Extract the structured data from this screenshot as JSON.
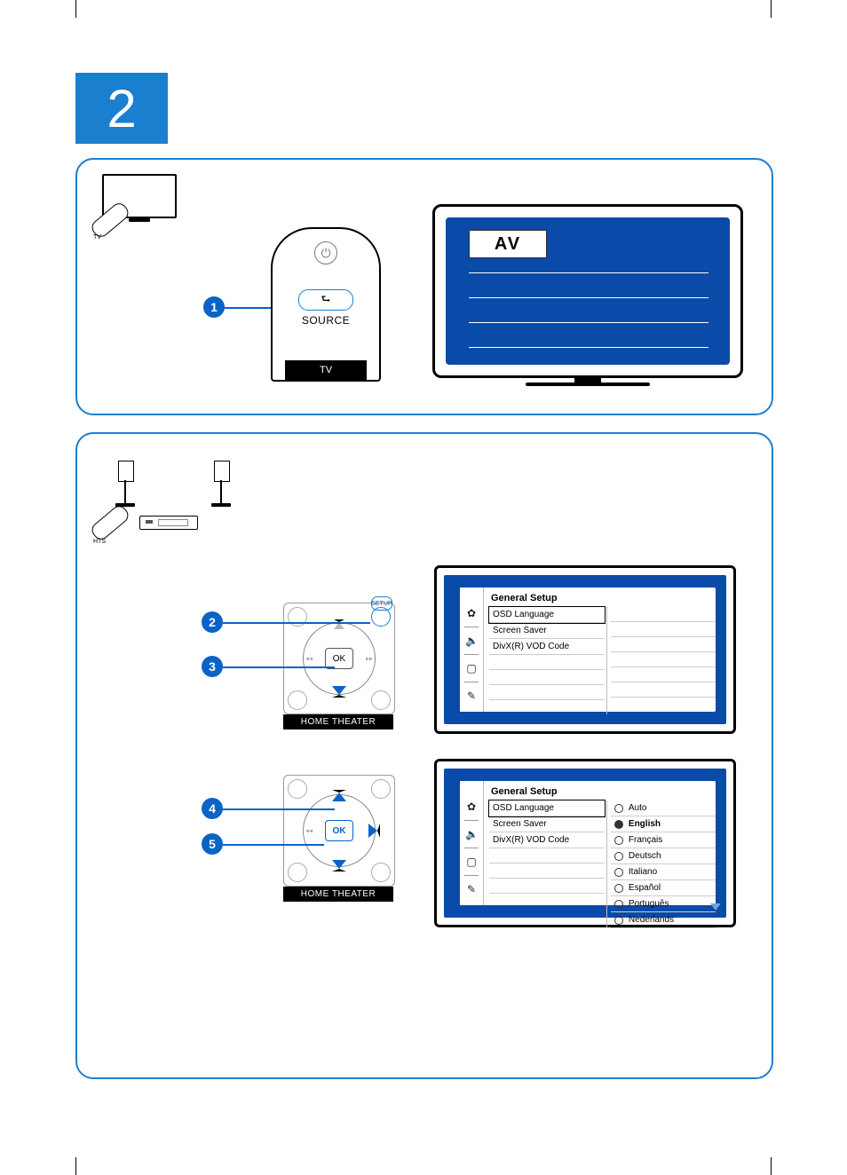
{
  "step_number": "2",
  "bullets": [
    "1",
    "2",
    "3",
    "4",
    "5"
  ],
  "tv_remote": {
    "source_label": "SOURCE",
    "base_label": "TV"
  },
  "tv_screen": {
    "selected_source": "AV"
  },
  "hts_remote": {
    "base_label": "HOME THEATER",
    "ok_label": "OK"
  },
  "menu1": {
    "title": "General Setup",
    "items": [
      {
        "label": "OSD Language",
        "selected": true
      },
      {
        "label": "Screen Saver"
      },
      {
        "label": "DivX(R) VOD Code"
      }
    ]
  },
  "menu2": {
    "title": "General Setup",
    "items_left": [
      {
        "label": "OSD Language",
        "selected": true
      },
      {
        "label": "Screen Saver"
      },
      {
        "label": "DivX(R) VOD Code"
      }
    ],
    "options": [
      {
        "label": "Auto",
        "selected": false
      },
      {
        "label": "English",
        "selected": true
      },
      {
        "label": "Français",
        "selected": false
      },
      {
        "label": "Deutsch",
        "selected": false
      },
      {
        "label": "Italiano",
        "selected": false
      },
      {
        "label": "Español",
        "selected": false
      },
      {
        "label": "Português",
        "selected": false
      },
      {
        "label": "Nederlands",
        "selected": false
      }
    ]
  }
}
